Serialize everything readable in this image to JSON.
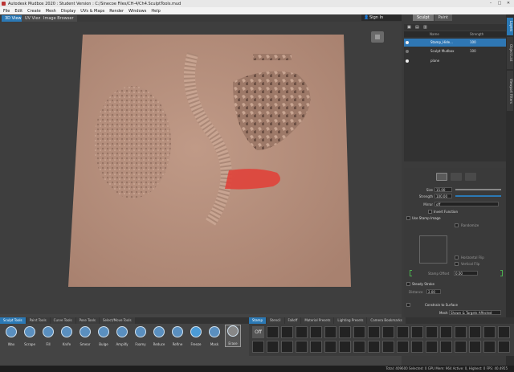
{
  "window": {
    "title": "Autodesk Mudbox 2020 : Student Version : C:/Sinecoe Files/CH-4/Ch4.SculptTools.mud"
  },
  "menu": [
    "File",
    "Edit",
    "Create",
    "Mesh",
    "Display",
    "UVs & Maps",
    "Render",
    "Windows",
    "Help"
  ],
  "viewport_tabs": [
    "3D View",
    "UV View",
    "Image Browser"
  ],
  "signin_label": "Sign In",
  "panel_tabs": [
    "Sculpt",
    "Paint"
  ],
  "side_tabs": [
    "Layers",
    "Object List",
    "Viewport Filters"
  ],
  "layers": {
    "header": [
      "",
      "",
      "Name",
      "",
      "Strength"
    ],
    "rows": [
      {
        "name": "Stamp_Hide...",
        "strength": "100",
        "selected": true
      },
      {
        "name": "Sculpt Mudbox",
        "strength": "100",
        "selected": false
      },
      {
        "name": "plane",
        "strength": "",
        "selected": false
      }
    ]
  },
  "properties": {
    "size_label": "Size",
    "size_value": "15.00",
    "strength_label": "Strength",
    "strength_value": "100.00",
    "mirror_label": "Mirror",
    "mirror_value": "off",
    "invert_function": "Invert Function",
    "use_stamp_image": "Use Stamp Image",
    "randomize": "Randomize",
    "horizontal_flip": "Horizontal Flip",
    "vertical_flip": "Vertical Flip",
    "stamp_offset_label": "Stamp Offset",
    "stamp_offset_value": "0.00",
    "steady_stroke": "Steady Stroke",
    "distance_label": "Distance",
    "distance_value": "2.00",
    "constrain": "Constrain to Surface",
    "mesh_label": "Mesh",
    "mesh_value": "Shown & Targets Affected"
  },
  "shelf_tabs": [
    "Sculpt Tools",
    "Paint Tools",
    "Curve Tools",
    "Pose Tools",
    "Select/Move Tools"
  ],
  "sculpt_tools": [
    "Wax",
    "Scrape",
    "Fill",
    "Knife",
    "Smear",
    "Bulge",
    "Amplify",
    "Foamy",
    "Reduce",
    "Refine",
    "Freeze",
    "Mask",
    "Erase"
  ],
  "stamp_tabs": [
    "Stamp",
    "Stencil",
    "Falloff",
    "Material Presets",
    "Lighting Presets",
    "Camera Bookmarks"
  ],
  "stamp_off_label": "Off",
  "status": "Total: 409600  Selected: 0  GPU Mem: 964  Active: 0, Highest: 0  FPS: 40.4955",
  "colors": {
    "accent": "#2b79b5",
    "clay": "#b8917e",
    "paint": "#e0433a"
  }
}
